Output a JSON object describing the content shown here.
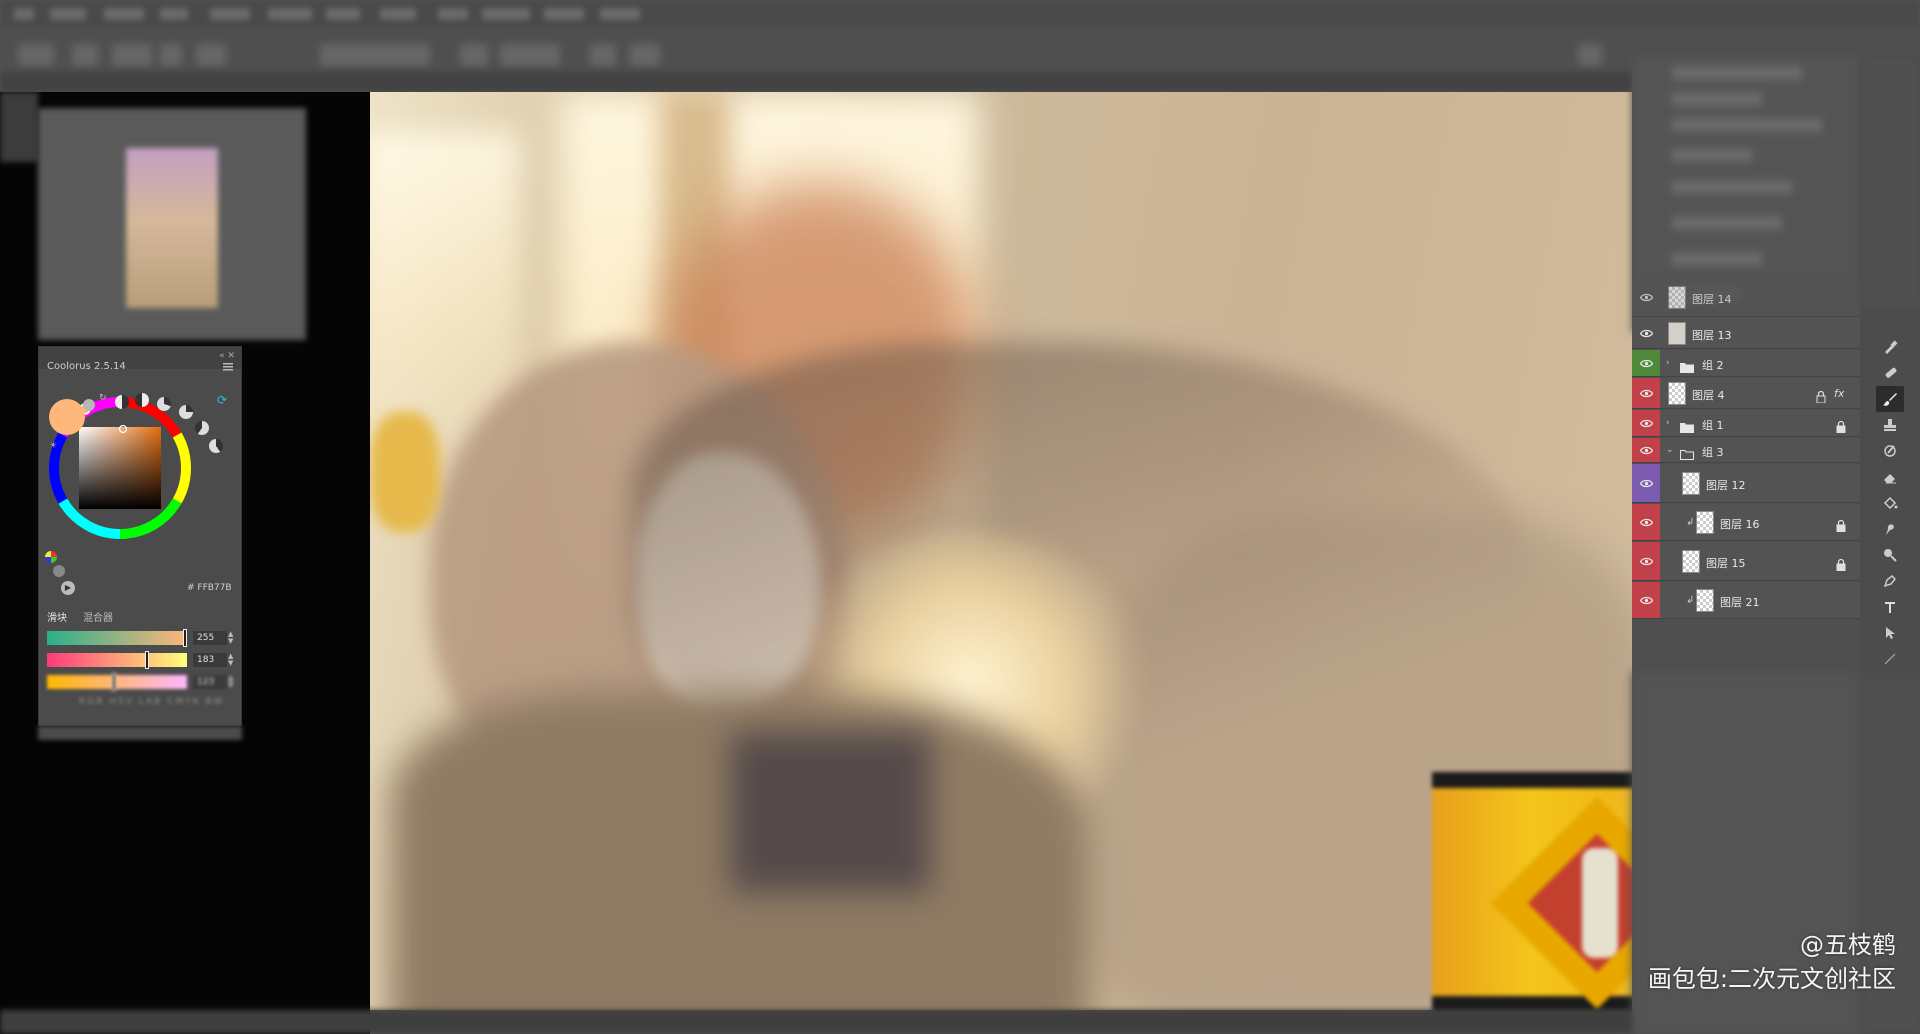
{
  "app": {
    "accent": "#e3404b"
  },
  "coolorus": {
    "title": "Coolorus 2.5.14",
    "hex": "# FFB77B",
    "current_color": "#FFB77B",
    "tabs": [
      "滑块",
      "混合器"
    ],
    "active_tab": "滑块",
    "sliders": [
      {
        "value": "255",
        "level": 1.0
      },
      {
        "value": "183",
        "level": 0.72
      },
      {
        "value": "123",
        "level": 0.48
      }
    ],
    "mode_tabs": "RGB HSV LAB CMYK BW"
  },
  "layers": {
    "rows": [
      {
        "name": "图层 14",
        "eye_color": "#535353",
        "kind": "layer",
        "thumb": "checker",
        "indent": 0
      },
      {
        "name": "图层 13",
        "eye_color": "#535353",
        "kind": "layer",
        "thumb": "solid",
        "indent": 0
      },
      {
        "name": "组 2",
        "eye_color": "#4f8a3a",
        "kind": "group-closed",
        "indent": 0
      },
      {
        "name": "图层 4",
        "eye_color": "#c2404a",
        "kind": "layer",
        "thumb": "checker",
        "indent": 0,
        "lock": true,
        "fx": "fx"
      },
      {
        "name": "组 1",
        "eye_color": "#c2404a",
        "kind": "group-closed",
        "indent": 0,
        "lock": true
      },
      {
        "name": "组 3",
        "eye_color": "#c2404a",
        "kind": "group-open",
        "indent": 0
      },
      {
        "name": "图层 12",
        "eye_color": "#7d5bb0",
        "kind": "layer",
        "thumb": "checker",
        "indent": 1
      },
      {
        "name": "图层 16",
        "eye_color": "#c2404a",
        "kind": "layer",
        "thumb": "checker",
        "indent": 2,
        "clip": true,
        "lock": true
      },
      {
        "name": "图层 15",
        "eye_color": "#c2404a",
        "kind": "layer",
        "thumb": "checker",
        "indent": 1,
        "lock": true
      },
      {
        "name": "图层 21",
        "eye_color": "#c2404a",
        "kind": "layer",
        "thumb": "checker",
        "indent": 2,
        "clip": true
      }
    ]
  },
  "tools": [
    "eyedropper-icon",
    "bandage-icon",
    "brush-icon",
    "stamp-icon",
    "history-brush-icon",
    "eraser-icon",
    "paint-bucket-icon",
    "smudge-icon",
    "dodge-icon",
    "pen-icon",
    "type-icon",
    "path-select-icon",
    "line-icon"
  ],
  "active_tool": "brush-icon",
  "watermark": {
    "author": "@五枝鹤",
    "site": "画包包:二次元文创社区"
  }
}
